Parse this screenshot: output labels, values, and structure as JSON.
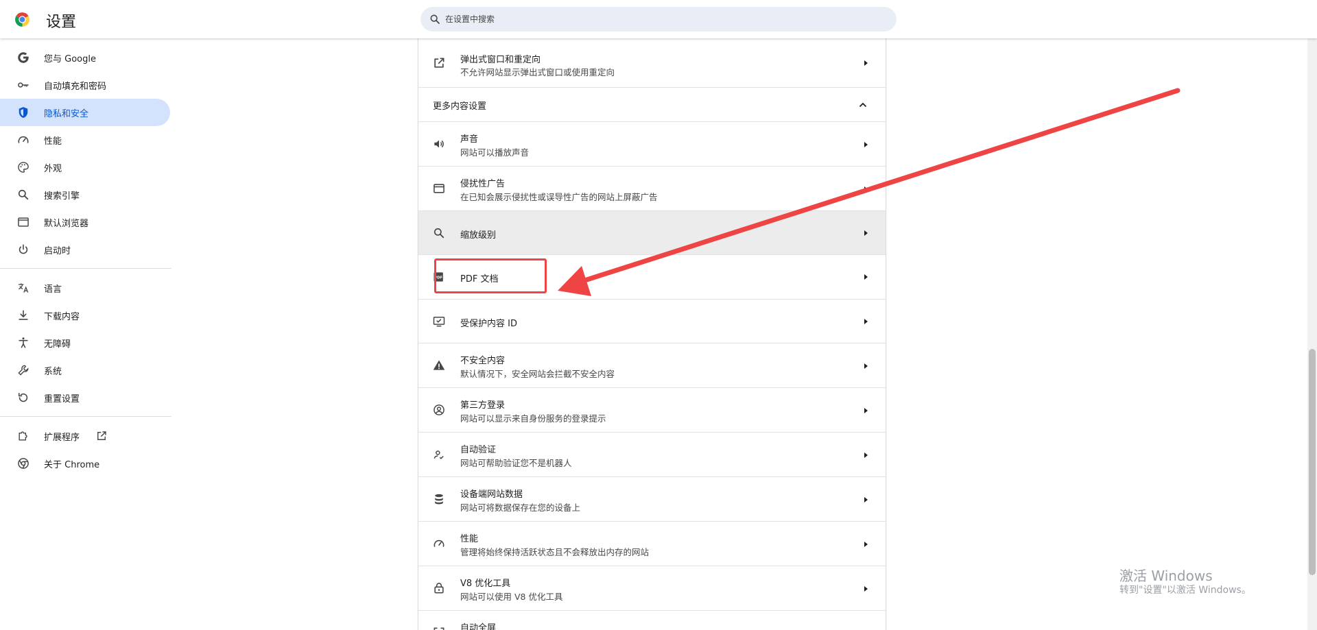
{
  "header": {
    "title": "设置",
    "search_placeholder": "在设置中搜索"
  },
  "sidebar": {
    "items": [
      {
        "label": "您与 Google",
        "icon": "google-g-icon"
      },
      {
        "label": "自动填充和密码",
        "icon": "key-icon"
      },
      {
        "label": "隐私和安全",
        "icon": "shield-icon",
        "active": true
      },
      {
        "label": "性能",
        "icon": "speedometer-icon"
      },
      {
        "label": "外观",
        "icon": "palette-icon"
      },
      {
        "label": "搜索引擎",
        "icon": "search-icon"
      },
      {
        "label": "默认浏览器",
        "icon": "browser-window-icon"
      },
      {
        "label": "启动时",
        "icon": "power-icon"
      },
      {
        "label": "语言",
        "icon": "translate-icon"
      },
      {
        "label": "下载内容",
        "icon": "download-icon"
      },
      {
        "label": "无障碍",
        "icon": "accessibility-icon"
      },
      {
        "label": "系统",
        "icon": "wrench-icon"
      },
      {
        "label": "重置设置",
        "icon": "reset-icon"
      },
      {
        "label": "扩展程序",
        "icon": "puzzle-icon"
      },
      {
        "label": "关于 Chrome",
        "icon": "chrome-icon"
      }
    ]
  },
  "content": {
    "rows": [
      {
        "title": "弹出式窗口和重定向",
        "subtitle": "不允许网站显示弹出式窗口或使用重定向",
        "icon": "open-external-icon"
      },
      {
        "title": "声音",
        "subtitle": "网站可以播放声音",
        "icon": "volume-icon"
      },
      {
        "title": "侵扰性广告",
        "subtitle": "在已知会展示侵扰性或误导性广告的网站上屏蔽广告",
        "icon": "ad-window-icon"
      },
      {
        "title": "缩放级别",
        "icon": "zoom-icon"
      },
      {
        "title": "PDF 文档",
        "icon": "pdf-icon"
      },
      {
        "title": "受保护内容 ID",
        "icon": "protected-content-icon"
      },
      {
        "title": "不安全内容",
        "subtitle": "默认情况下，安全网站会拦截不安全内容",
        "icon": "warning-icon"
      },
      {
        "title": "第三方登录",
        "subtitle": "网站可以显示来自身份服务的登录提示",
        "icon": "account-circle-icon"
      },
      {
        "title": "自动验证",
        "subtitle": "网站可帮助验证您不是机器人",
        "icon": "person-check-icon"
      },
      {
        "title": "设备端网站数据",
        "subtitle": "网站可将数据保存在您的设备上",
        "icon": "database-icon"
      },
      {
        "title": "性能",
        "subtitle": "管理将始终保持活跃状态且不会释放出内存的网站",
        "icon": "speedometer-icon"
      },
      {
        "title": "V8 优化工具",
        "subtitle": "网站可以使用 V8 优化工具",
        "icon": "lock-icon"
      },
      {
        "title": "自动全屏",
        "icon": "fullscreen-icon"
      }
    ],
    "section_more": "更多内容设置"
  },
  "watermark": {
    "title": "激活 Windows",
    "subtitle": "转到\"设置\"以激活 Windows。"
  },
  "colors": {
    "accent": "#0b57d0",
    "active_bg": "#d3e3fd",
    "annotation": "#ef4444"
  }
}
